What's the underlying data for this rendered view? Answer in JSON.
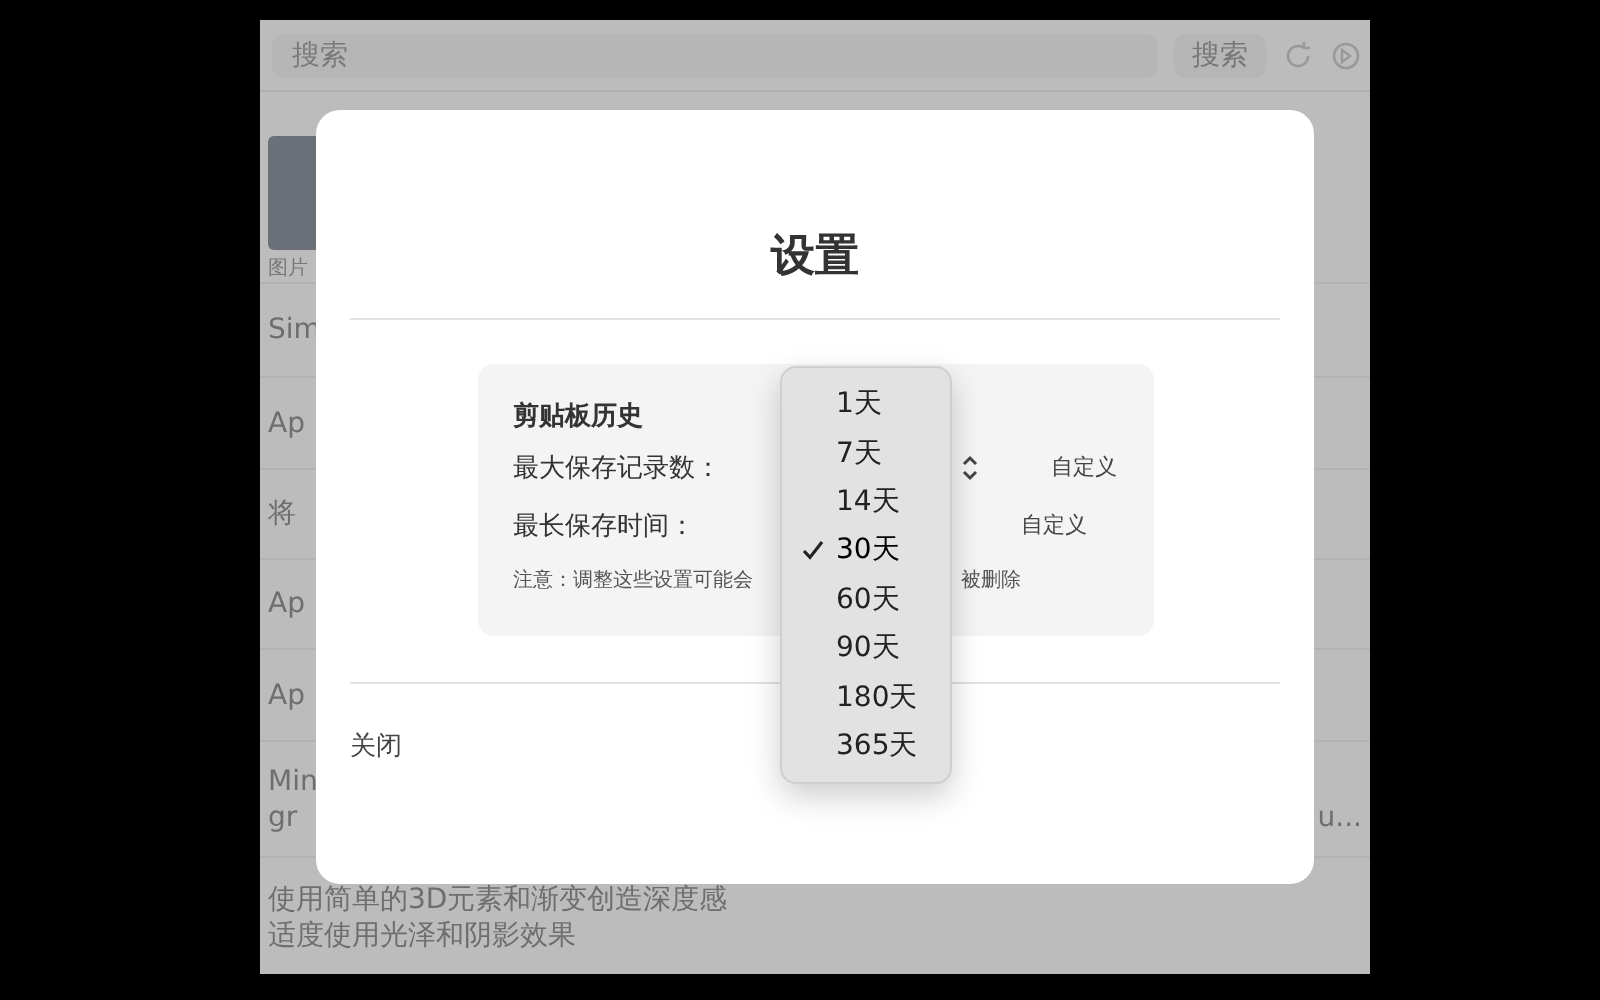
{
  "app": {
    "search": {
      "placeholder": "搜索"
    },
    "search_button": "搜索",
    "thumbnail_caption": "图片",
    "rows": [
      {
        "lines": [
          "Sim"
        ]
      },
      {
        "lines": [
          "Ap"
        ]
      },
      {
        "lines": [
          "将"
        ]
      },
      {
        "lines": [
          "Ap"
        ]
      },
      {
        "lines": [
          "Ap"
        ]
      },
      {
        "lines": [
          "Min",
          "gr"
        ],
        "trailing": "u..."
      },
      {
        "lines": [
          "使用简单的3D元素和渐变创造深度感",
          "适度使用光泽和阴影效果"
        ]
      }
    ]
  },
  "dialog": {
    "title": "设置",
    "section": {
      "title": "剪贴板历史",
      "rows": [
        {
          "label": "最大保存记录数：",
          "custom": "自定义",
          "chevron": true
        },
        {
          "label": "最长保存时间：",
          "custom": "自定义",
          "chevron": false
        }
      ],
      "note_start": "注意：调整这些设置可能会",
      "note_end": "被删除"
    },
    "close": "关闭"
  },
  "menu": {
    "items": [
      {
        "label": "1天",
        "selected": false
      },
      {
        "label": "7天",
        "selected": false
      },
      {
        "label": "14天",
        "selected": false
      },
      {
        "label": "30天",
        "selected": true
      },
      {
        "label": "60天",
        "selected": false
      },
      {
        "label": "90天",
        "selected": false
      },
      {
        "label": "180天",
        "selected": false
      },
      {
        "label": "365天",
        "selected": false
      }
    ]
  }
}
